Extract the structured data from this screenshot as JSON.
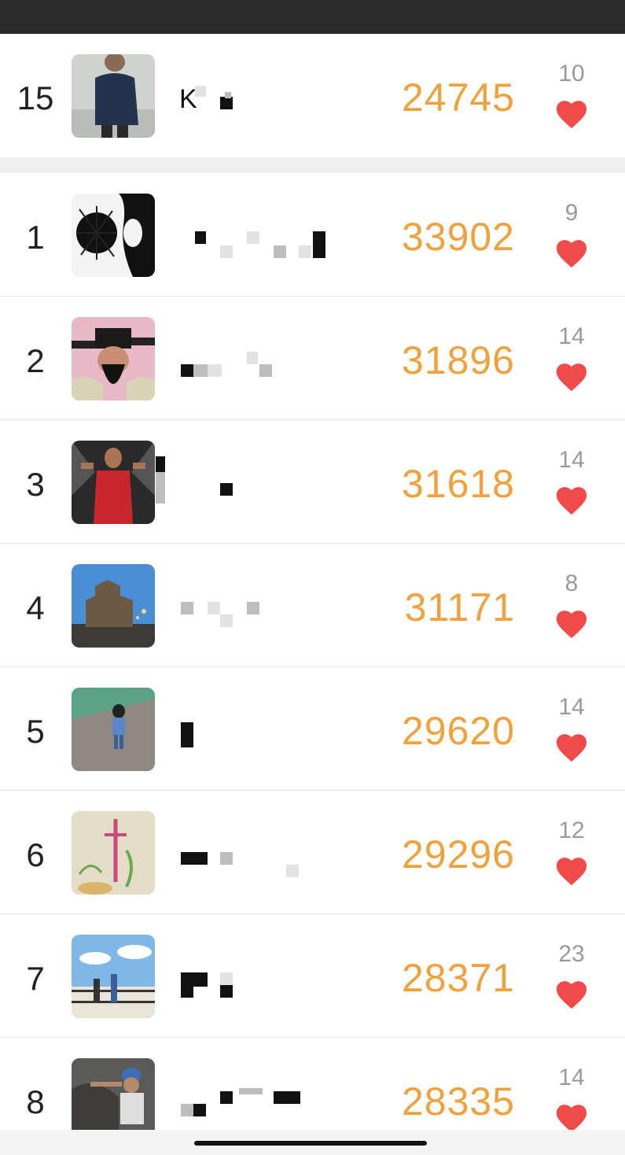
{
  "my_entry": {
    "rank": "15",
    "name_initial": "K",
    "score": "24745",
    "likes": "10"
  },
  "leaderboard": [
    {
      "rank": "1",
      "score": "33902",
      "likes": "9"
    },
    {
      "rank": "2",
      "score": "31896",
      "likes": "14"
    },
    {
      "rank": "3",
      "score": "31618",
      "likes": "14"
    },
    {
      "rank": "4",
      "score": "31171",
      "likes": "8"
    },
    {
      "rank": "5",
      "score": "29620",
      "likes": "14"
    },
    {
      "rank": "6",
      "score": "29296",
      "likes": "12"
    },
    {
      "rank": "7",
      "score": "28371",
      "likes": "23"
    },
    {
      "rank": "8",
      "score": "28335",
      "likes": "14"
    }
  ],
  "icons": {
    "like": "heart-icon",
    "avatar": "avatar-photo"
  },
  "colors": {
    "score": "#f0a13c",
    "heart": "#f04a4a",
    "likes": "#9a9a9a",
    "status_bar": "#2b2b2b"
  }
}
